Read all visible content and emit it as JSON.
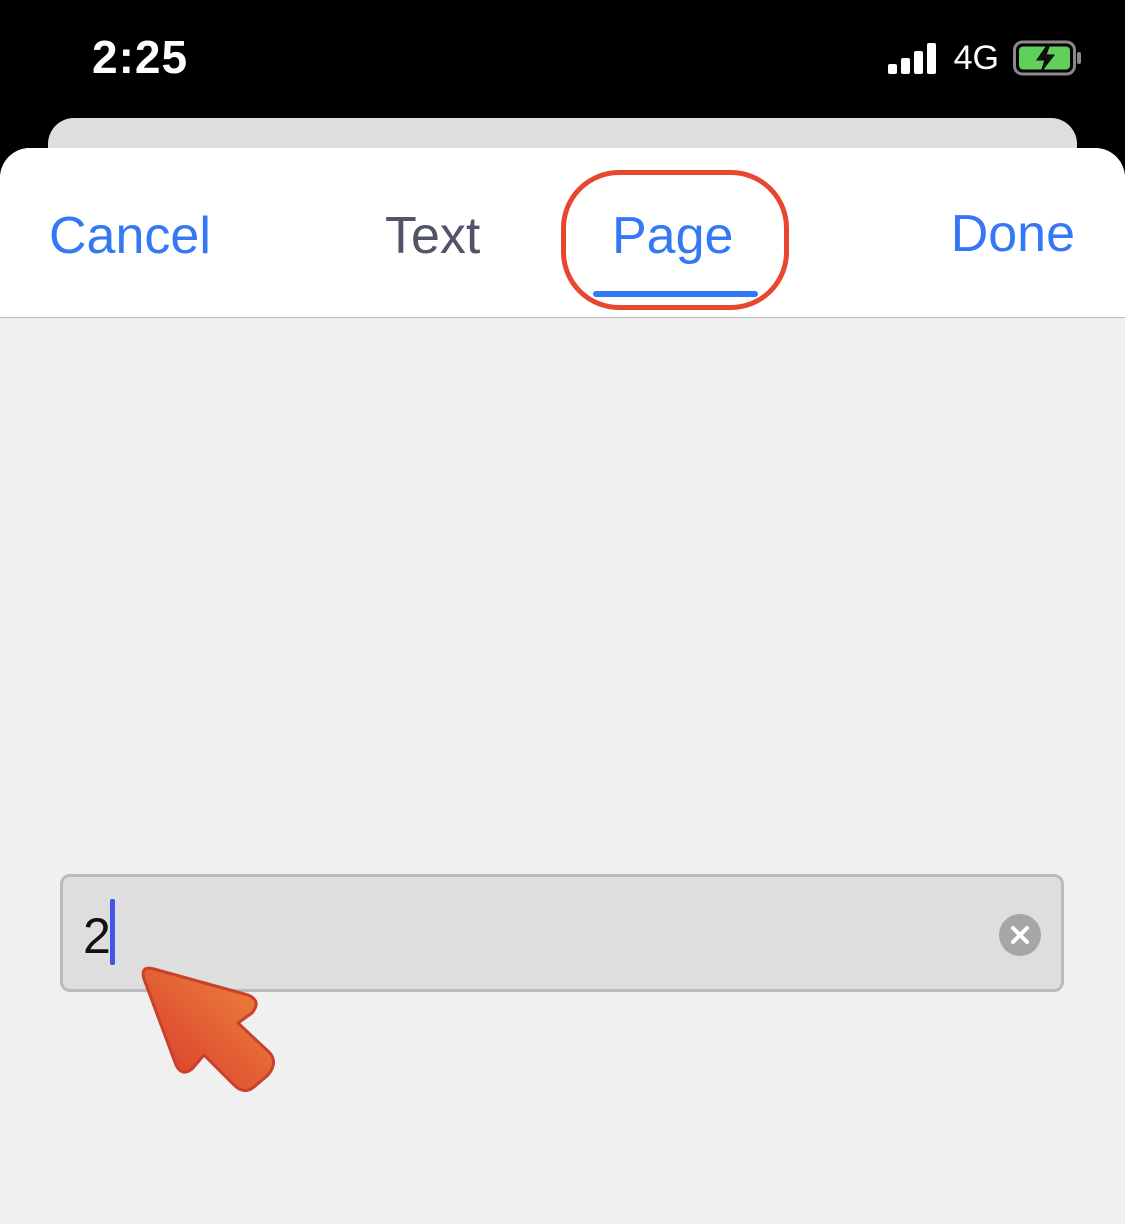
{
  "status_bar": {
    "time": "2:25",
    "network": "4G",
    "icons": [
      "signal-icon",
      "battery-charging-icon"
    ]
  },
  "nav": {
    "cancel_label": "Cancel",
    "done_label": "Done",
    "tabs": [
      {
        "label": "Text",
        "selected": false
      },
      {
        "label": "Page",
        "selected": true
      }
    ]
  },
  "page_input": {
    "value": "2",
    "clear_icon": "clear-icon"
  },
  "annotations": {
    "highlight_color": "#e7472e",
    "pointer_icon": "pointer-arrow-icon"
  },
  "colors": {
    "accent": "#3478f6",
    "tab_inactive": "#525469",
    "sheet_background": "#f0f0f0",
    "input_background": "#dedede",
    "battery_fill": "#5fd15a"
  }
}
